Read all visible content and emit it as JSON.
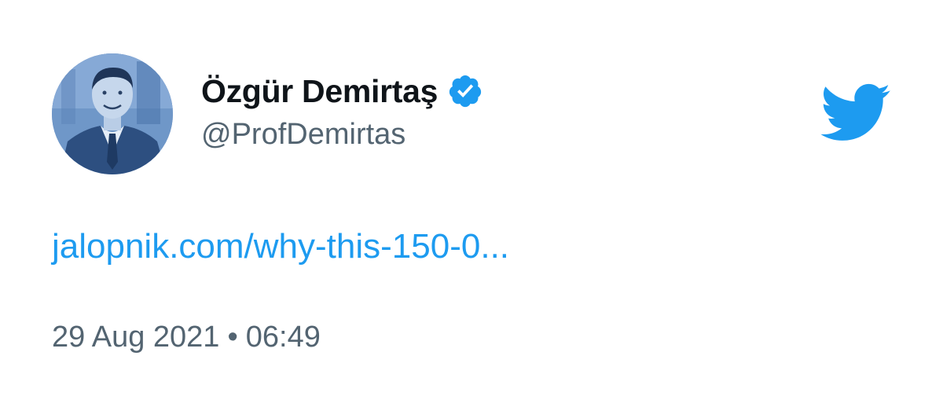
{
  "author": {
    "display_name": "Özgür Demirtaş",
    "handle": "@ProfDemirtas",
    "verified": true,
    "avatar_icon": "profile-photo",
    "badge_icon": "verified-check-icon"
  },
  "brand": {
    "logo_icon": "twitter-bird-icon",
    "accent_color": "#1d9bf0"
  },
  "tweet": {
    "link_text": "jalopnik.com/why-this-150-0...",
    "date": "29 Aug 2021",
    "separator": "•",
    "time": "06:49"
  },
  "colors": {
    "name": "#0f1419",
    "secondary": "#536471",
    "link": "#1d9bf0",
    "background": "#ffffff"
  }
}
